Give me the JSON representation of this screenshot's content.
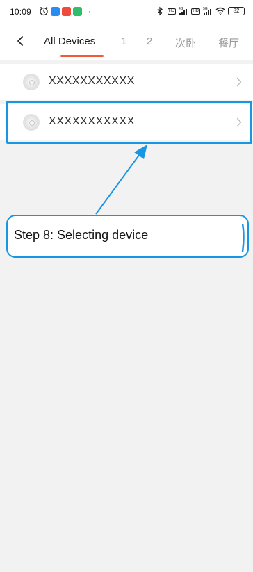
{
  "status_bar": {
    "time": "10:09",
    "battery": "82",
    "network_labels": [
      "4G",
      "5G"
    ],
    "hd_label": "HD",
    "dot": "·",
    "icons": [
      "alarm-icon",
      "app-badge-blue",
      "app-badge-red",
      "app-badge-green",
      "bluetooth-icon",
      "signal-icon",
      "wifi-icon",
      "battery-icon"
    ]
  },
  "header": {
    "back_icon": "chevron-left-icon",
    "tabs": [
      {
        "label": "All Devices",
        "active": true
      },
      {
        "label": "1",
        "active": false
      },
      {
        "label": "2",
        "active": false
      },
      {
        "label": "次卧",
        "active": false
      },
      {
        "label": "餐厅",
        "active": false
      }
    ],
    "active_underline_color": "#f05a34"
  },
  "devices": [
    {
      "name": "XXXXXXXXXXX",
      "icon": "device-bulb-icon"
    },
    {
      "name": "XXXXXXXXXXX",
      "icon": "device-bulb-icon",
      "highlighted": true
    }
  ],
  "annotation": {
    "text": "Step 8: Selecting device",
    "color": "#1996e3"
  }
}
